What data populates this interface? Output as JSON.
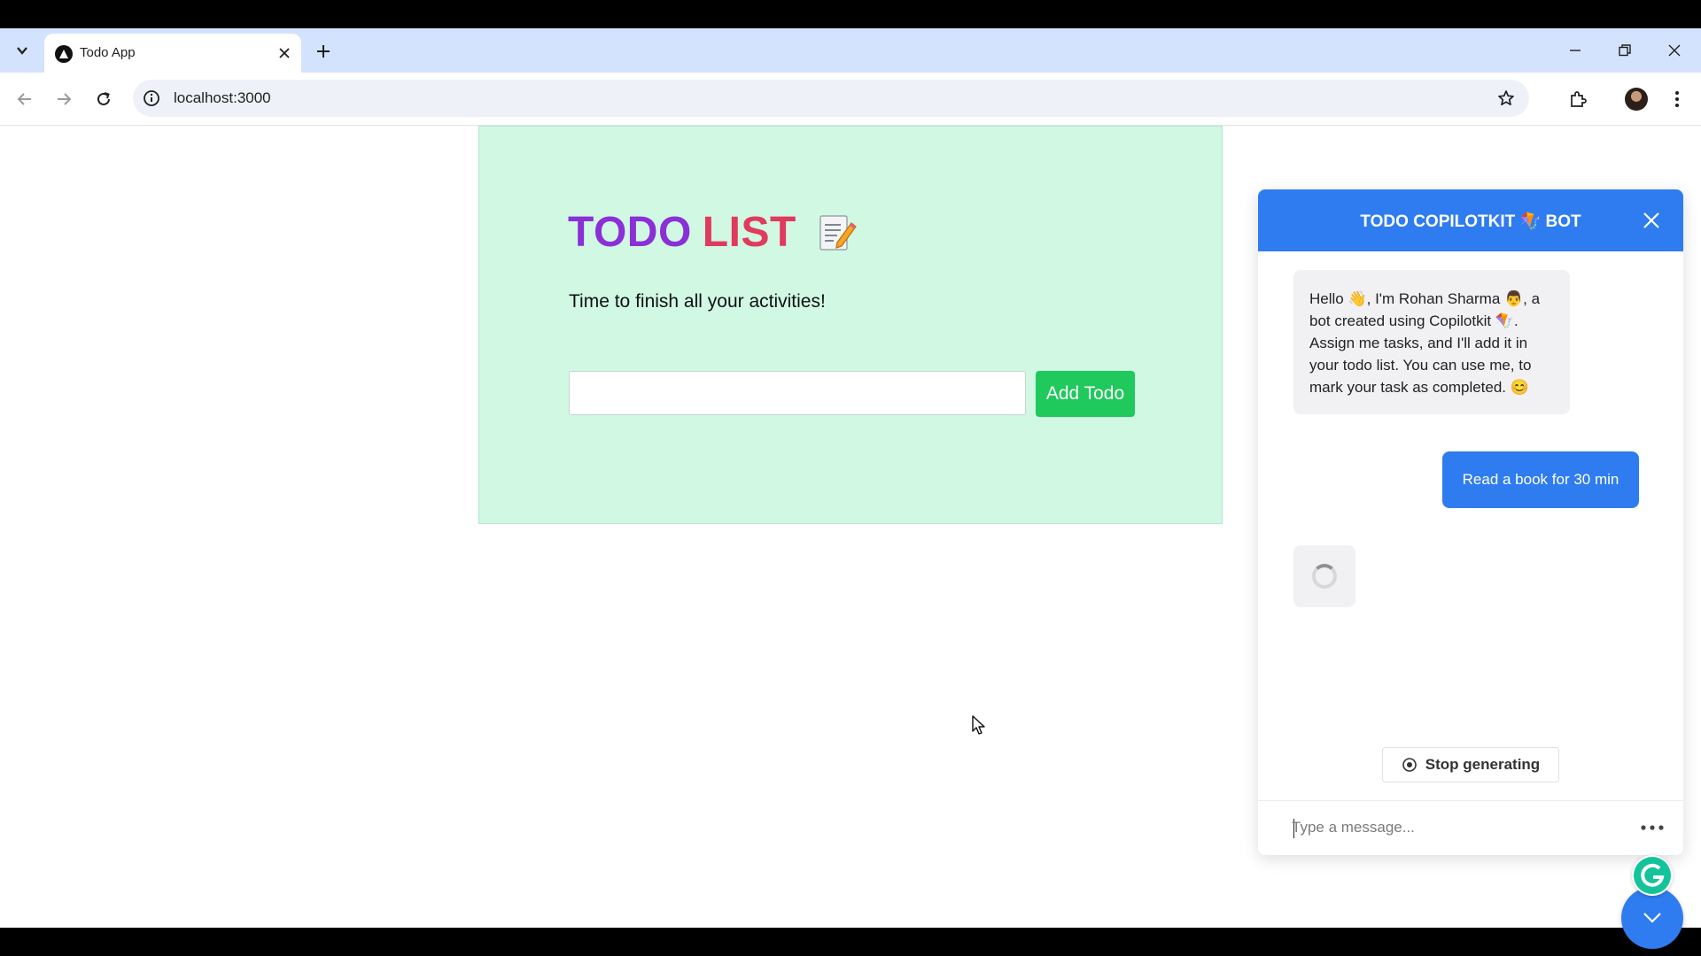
{
  "browser": {
    "tab_title": "Todo App",
    "url": "localhost:3000"
  },
  "todo": {
    "title_word1": "TODO",
    "title_word2": "LIST",
    "subtitle": "Time to finish all your activities!",
    "input_value": "",
    "add_button_label": "Add Todo",
    "colors": {
      "card_bg": "#d0f8e3",
      "title_word1": "#8b2fd6",
      "title_word2": "#e03a5c",
      "button": "#1fc95c"
    }
  },
  "chat": {
    "header_title": "TODO COPILOTKIT 🪁 BOT",
    "bot_message": "Hello 👋, I'm Rohan Sharma 👨, a bot created using Copilotkit 🪁. Assign me tasks, and I'll add it in your todo list. You can use me, to mark your task as completed. 😊",
    "user_message": "Read a book for 30 min",
    "stop_label": "Stop generating",
    "input_placeholder": "Type a message...",
    "colors": {
      "accent": "#2f7cf0"
    }
  },
  "icons": {
    "tab_search": "chevron-down-icon",
    "favicon": "triangle-logo-icon",
    "close_tab": "close-icon",
    "new_tab": "plus-icon",
    "back": "back-arrow-icon",
    "forward": "forward-arrow-icon",
    "reload": "reload-icon",
    "site_info": "info-icon",
    "bookmark": "star-icon",
    "extensions": "puzzle-icon",
    "menu": "kebab-menu-icon",
    "chat_close": "close-icon",
    "stop": "stop-circle-icon",
    "fab": "chevron-down-icon",
    "grammarly": "grammarly-icon"
  }
}
